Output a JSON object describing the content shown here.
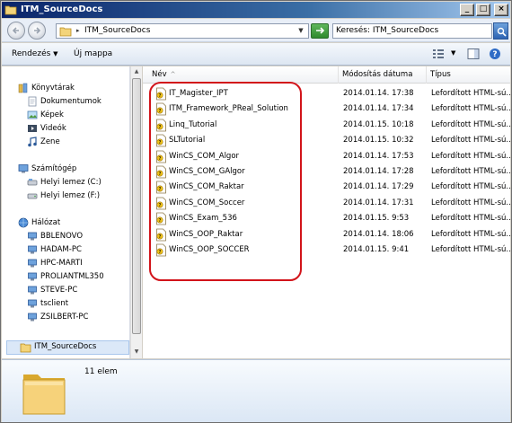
{
  "window": {
    "title": "ITM_SourceDocs"
  },
  "address": {
    "path": "ITM_SourceDocs"
  },
  "search": {
    "placeholder": "Keresés: ITM_SourceDocs"
  },
  "toolbar": {
    "organize_label": "Rendezés",
    "new_folder_label": "Új mappa"
  },
  "nav": {
    "libraries": {
      "label": "Könyvtárak",
      "items": [
        "Dokumentumok",
        "Képek",
        "Videók",
        "Zene"
      ]
    },
    "computer": {
      "label": "Számítógép",
      "items": [
        "Helyi lemez (C:)",
        "Helyi lemez (F:)"
      ]
    },
    "network": {
      "label": "Hálózat",
      "items": [
        "BBLENOVO",
        "HADAM-PC",
        "HPC-MARTI",
        "PROLIANTML350",
        "STEVE-PC",
        "tsclient",
        "ZSILBERT-PC"
      ]
    },
    "selected": {
      "label": "ITM_SourceDocs"
    }
  },
  "columns": {
    "name": "Név",
    "date": "Módosítás dátuma",
    "type": "Típus"
  },
  "files": [
    {
      "name": "IT_Magister_IPT",
      "date": "2014.01.14. 17:38",
      "type": "Lefordított HTML-sú..."
    },
    {
      "name": "ITM_Framework_PReal_Solution",
      "date": "2014.01.14. 17:34",
      "type": "Lefordított HTML-sú..."
    },
    {
      "name": "Linq_Tutorial",
      "date": "2014.01.15. 10:18",
      "type": "Lefordított HTML-sú..."
    },
    {
      "name": "SLTutorial",
      "date": "2014.01.15. 10:32",
      "type": "Lefordított HTML-sú..."
    },
    {
      "name": "WinCS_COM_Algor",
      "date": "2014.01.14. 17:53",
      "type": "Lefordított HTML-sú..."
    },
    {
      "name": "WinCS_COM_GAlgor",
      "date": "2014.01.14. 17:28",
      "type": "Lefordított HTML-sú..."
    },
    {
      "name": "WinCS_COM_Raktar",
      "date": "2014.01.14. 17:29",
      "type": "Lefordított HTML-sú..."
    },
    {
      "name": "WinCS_COM_Soccer",
      "date": "2014.01.14. 17:31",
      "type": "Lefordított HTML-sú..."
    },
    {
      "name": "WinCS_Exam_536",
      "date": "2014.01.15. 9:53",
      "type": "Lefordított HTML-sú..."
    },
    {
      "name": "WinCS_OOP_Raktar",
      "date": "2014.01.14. 18:06",
      "type": "Lefordított HTML-sú..."
    },
    {
      "name": "WinCS_OOP_SOCCER",
      "date": "2014.01.15. 9:41",
      "type": "Lefordított HTML-sú..."
    }
  ],
  "details": {
    "count_label": "11 elem"
  },
  "colors": {
    "title_bar": "#0a246a",
    "highlight_ring": "#d2141a",
    "selection": "#dbe8f8"
  }
}
